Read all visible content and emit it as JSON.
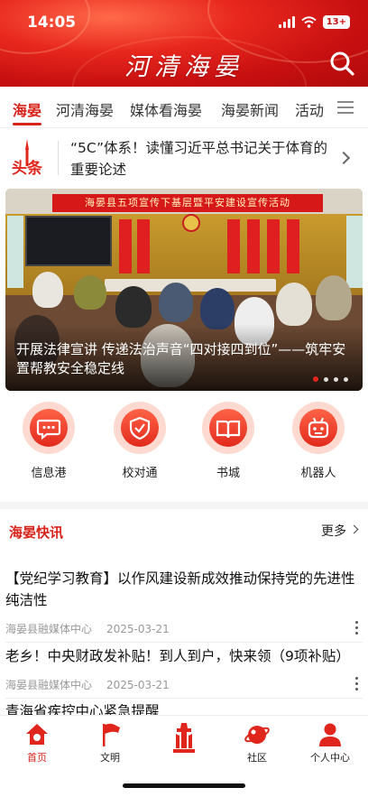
{
  "status_bar": {
    "time": "14:05",
    "battery": "13+"
  },
  "header": {
    "app_title": "河清海晏"
  },
  "tabs": [
    {
      "label": "海晏",
      "active": true
    },
    {
      "label": "河清海晏"
    },
    {
      "label": "媒体看海晏"
    },
    {
      "label": "海晏新闻"
    },
    {
      "label": "活动"
    }
  ],
  "headline": {
    "badge": "头条",
    "text": "“5C”体系！读懂习近平总书记关于体育的重要论述"
  },
  "banner": {
    "backdrop_text": "海晏县五项宣传下基层暨平安建设宣传活动",
    "caption": "开展法律宣讲 传递法治声音“四对接四到位”——筑牢安置帮教安全稳定线",
    "slide_count": 4,
    "active_slide": 1
  },
  "quick_links": [
    {
      "label": "信息港",
      "icon": "chat-bubble-icon"
    },
    {
      "label": "校对通",
      "icon": "shield-check-icon"
    },
    {
      "label": "书城",
      "icon": "book-icon"
    },
    {
      "label": "机器人",
      "icon": "robot-icon"
    }
  ],
  "news_section": {
    "title": "海晏快讯",
    "more_label": "更多",
    "items": [
      {
        "title": "【党纪学习教育】以作风建设新成效推动保持党的先进性纯洁性",
        "source": "海晏县融媒体中心",
        "date": "2025-03-21"
      },
      {
        "title": "老乡！中央财政发补贴！到人到户，快来领（9项补贴）",
        "source": "海晏县融媒体中心",
        "date": "2025-03-21"
      },
      {
        "title": "青海省疾控中心紧急提醒",
        "source": "",
        "date": ""
      }
    ]
  },
  "bottom_nav": [
    {
      "label": "首页",
      "icon": "home-icon",
      "active": true
    },
    {
      "label": "文明",
      "icon": "flag-icon"
    },
    {
      "label": "",
      "icon": "monument-icon"
    },
    {
      "label": "社区",
      "icon": "planet-icon"
    },
    {
      "label": "个人中心",
      "icon": "user-icon"
    }
  ],
  "colors": {
    "brand_red": "#d8231b",
    "header_red": "#c70f10"
  }
}
